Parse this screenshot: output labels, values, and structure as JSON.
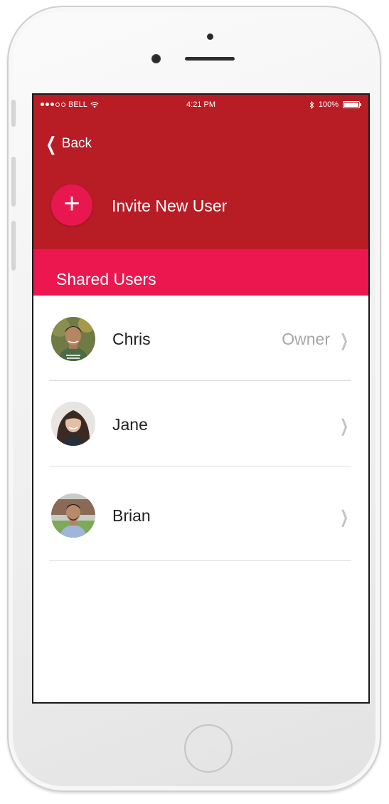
{
  "status_bar": {
    "carrier": "BELL",
    "time": "4:21 PM",
    "battery": "100%",
    "signal_bars_filled": 3,
    "signal_bars_total": 5
  },
  "nav": {
    "back_label": "Back"
  },
  "invite": {
    "label": "Invite New User",
    "icon": "+"
  },
  "section": {
    "title": "Shared Users"
  },
  "users": [
    {
      "name": "Chris",
      "role": "Owner"
    },
    {
      "name": "Jane",
      "role": ""
    },
    {
      "name": "Brian",
      "role": ""
    }
  ],
  "colors": {
    "header_red": "#b81c25",
    "accent_pink": "#ec174e",
    "plus_circle": "#e8174f"
  }
}
